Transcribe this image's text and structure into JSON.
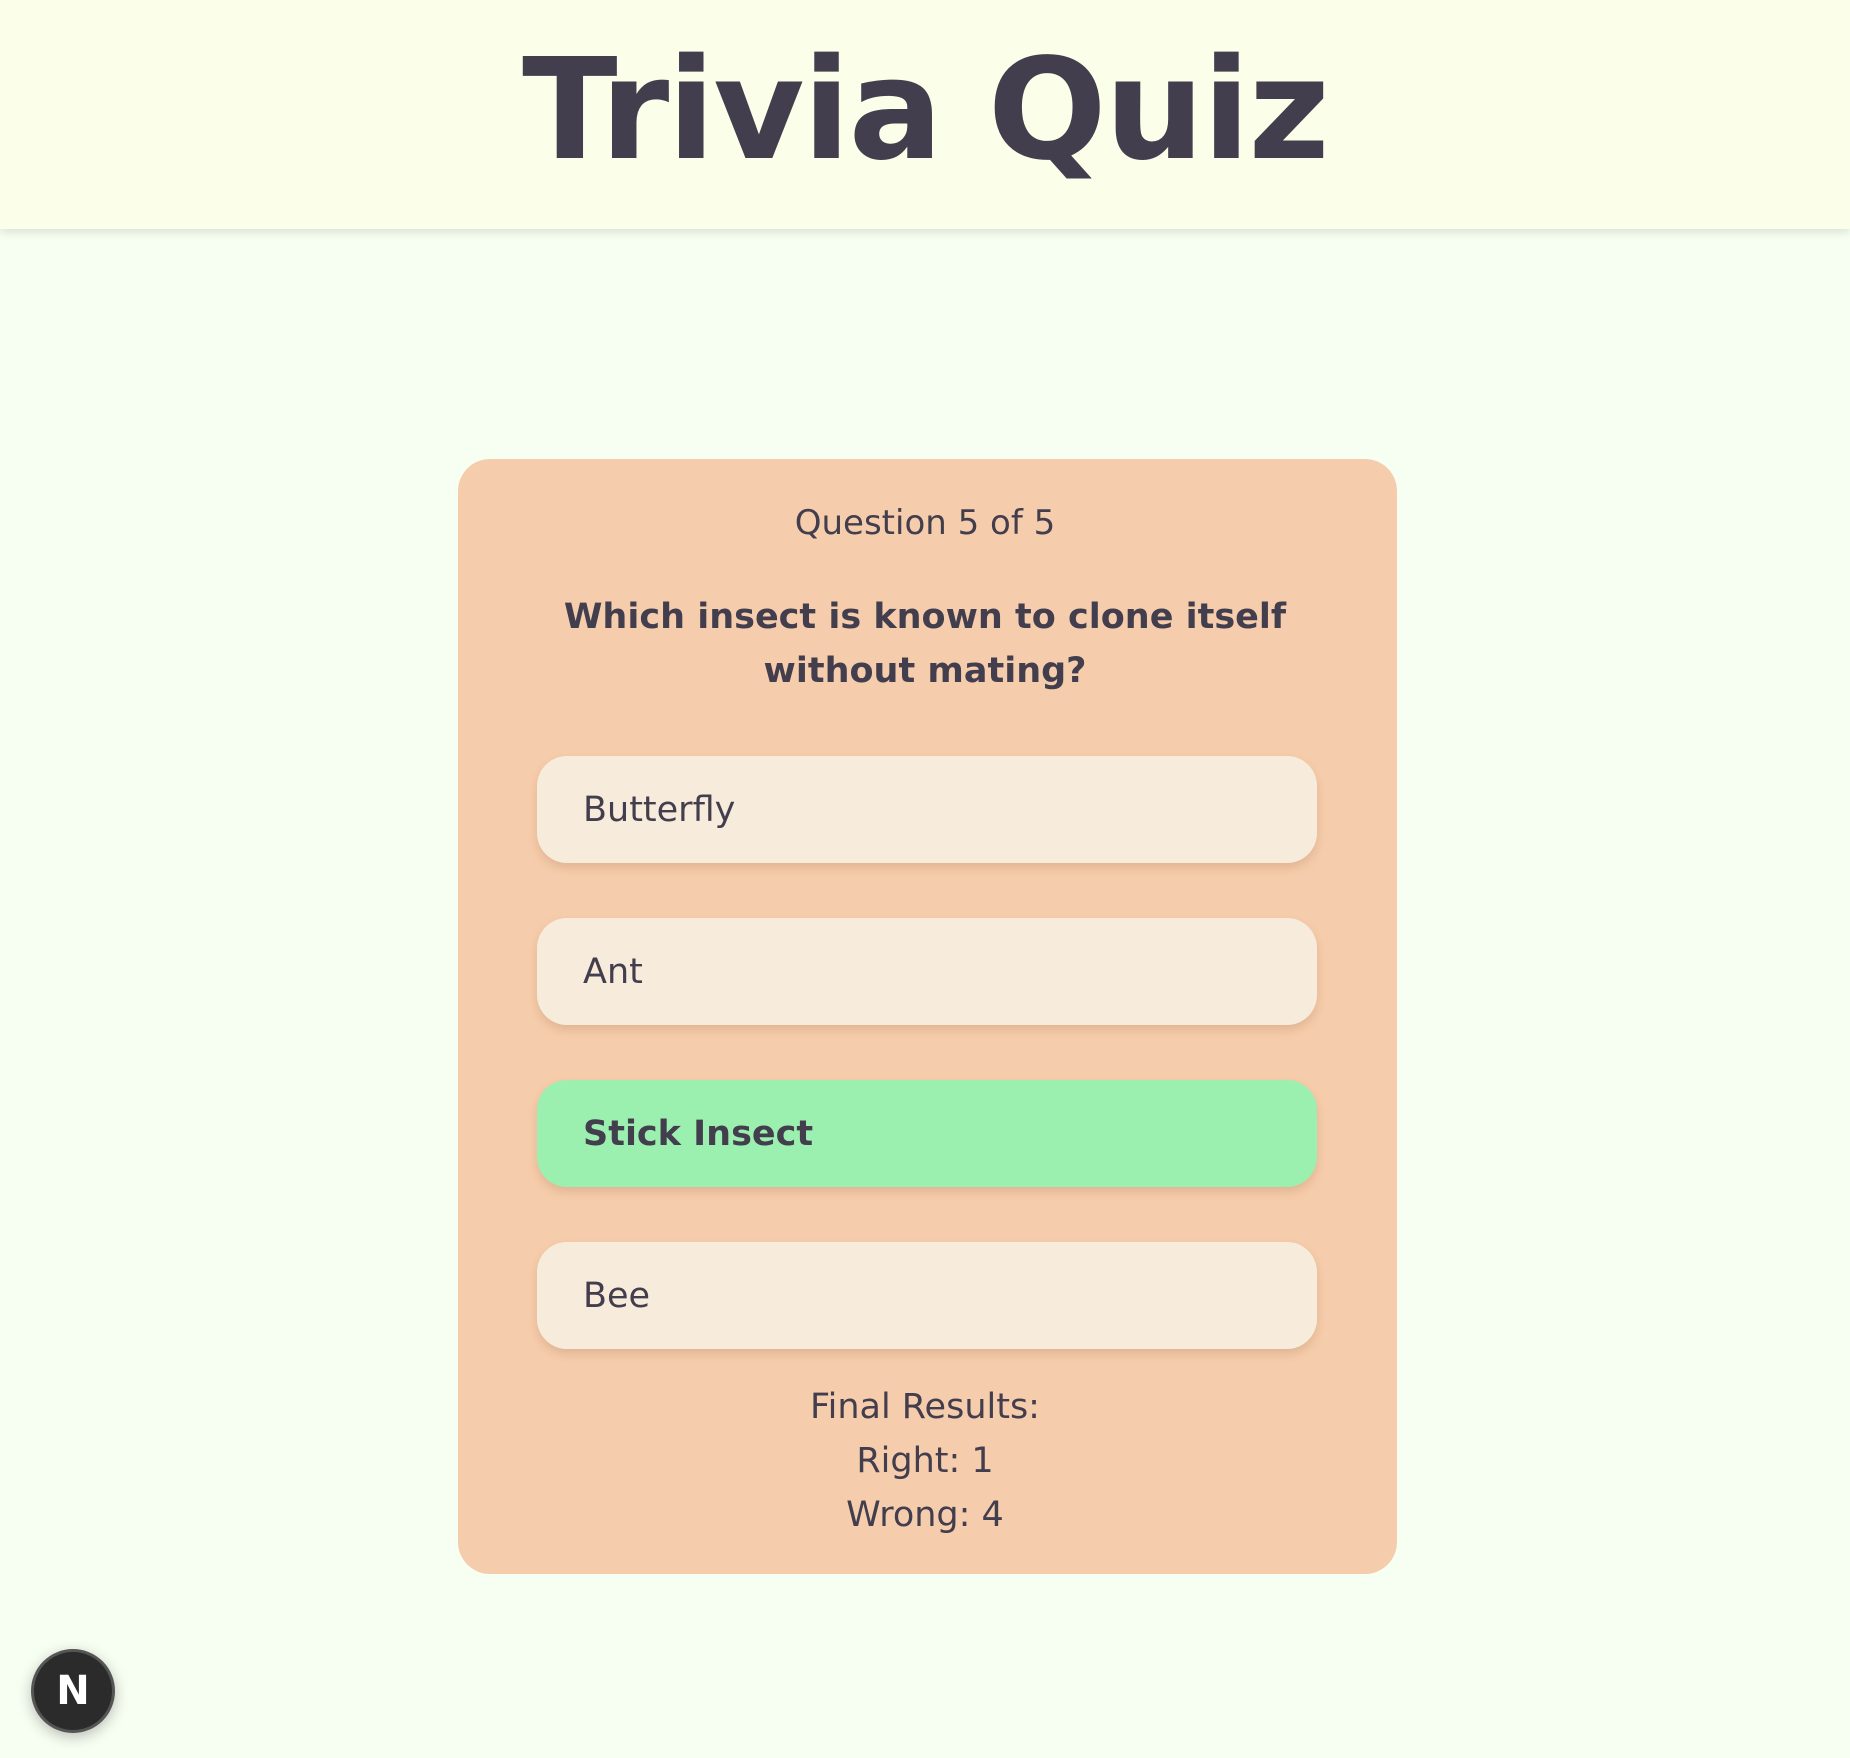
{
  "header": {
    "title": "Trivia Quiz"
  },
  "quiz": {
    "counter": "Question 5 of 5",
    "question": "Which insect is known to clone itself without mating?",
    "options": [
      {
        "label": "Butterfly",
        "state": "default"
      },
      {
        "label": "Ant",
        "state": "default"
      },
      {
        "label": "Stick Insect",
        "state": "correct"
      },
      {
        "label": "Bee",
        "state": "default"
      }
    ],
    "results": {
      "title": "Final Results:",
      "right": "Right: 1",
      "wrong": "Wrong: 4"
    }
  },
  "devtools": {
    "badge_letter": "N",
    "icon": "nextjs-logo-icon"
  },
  "colors": {
    "page_bg": "#f7fef2",
    "header_bg": "#fbfee8",
    "card_bg": "#f6cdac",
    "option_bg": "#f7ebdb",
    "correct_bg": "#9bf0af",
    "text": "#433e4d"
  }
}
